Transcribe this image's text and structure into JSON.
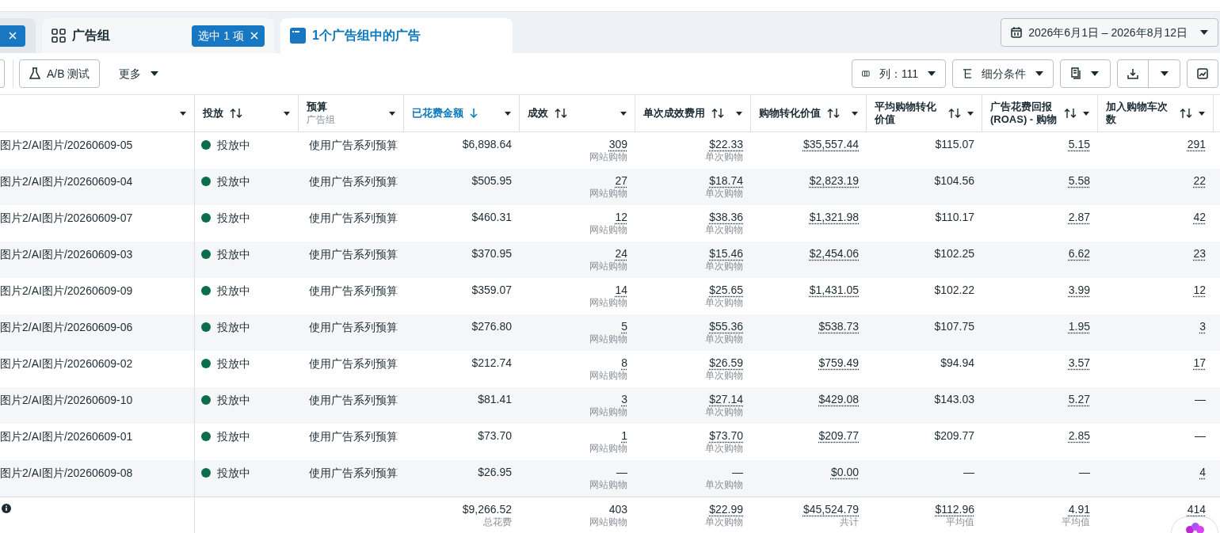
{
  "tabs": [
    {
      "kind": "cut",
      "selected": false
    },
    {
      "kind": "adsets",
      "label": "广告组",
      "chip": "选中 1 项",
      "selected": false
    },
    {
      "kind": "ads",
      "label": "1个广告组中的广告",
      "selected": true
    }
  ],
  "date_range": "2026年6月1日 – 2026年8月12日",
  "toolbar_left": [
    {
      "kind": "ab",
      "label": "A/B 测试"
    },
    {
      "kind": "more",
      "label": "更多"
    }
  ],
  "toolbar_right": [
    {
      "kind": "columns",
      "label": "列：111"
    },
    {
      "kind": "breakdown",
      "label": "细分条件"
    },
    {
      "kind": "reports"
    },
    {
      "kind": "export"
    },
    {
      "kind": "chart"
    }
  ],
  "table": {
    "columns": [
      {
        "sortable": false
      },
      {
        "label": "投放",
        "sortable": true,
        "active": false
      },
      {
        "label": "预算",
        "sublabel": "广告组",
        "sortable": false,
        "active": false
      },
      {
        "label": "已花费金额",
        "sortable": true,
        "active": true,
        "dotted": false
      },
      {
        "label": "成效",
        "sortable": true,
        "active": false,
        "dotted": true
      },
      {
        "label": "单次成效费用",
        "sortable": true,
        "active": false,
        "dotted": true
      },
      {
        "label": "购物转化价值",
        "sortable": true,
        "active": false,
        "dotted": true
      },
      {
        "label": "平均购物转化价值",
        "sortable": true,
        "active": false,
        "dotted": false
      },
      {
        "label": "广告花费回报 (ROAS) - 购物",
        "sortable": true,
        "active": false,
        "dotted": true
      },
      {
        "label": "加入购物车次数",
        "sortable": true,
        "active": false,
        "dotted": true
      }
    ],
    "rows": [
      {
        "name": "图片2/AI图片/20260609-05",
        "status": "投放中",
        "active": true,
        "budget": "使用广告系列预算",
        "metrics": [
          [
            "$6,898.64"
          ],
          [
            "309",
            "网站购物"
          ],
          [
            "$22.33",
            "单次购物"
          ],
          [
            "$35,557.44"
          ],
          [
            "$115.07"
          ],
          [
            "5.15"
          ],
          [
            "291"
          ]
        ]
      },
      {
        "name": "图片2/AI图片/20260609-04",
        "status": "投放中",
        "active": true,
        "budget": "使用广告系列预算",
        "metrics": [
          [
            "$505.95"
          ],
          [
            "27",
            "网站购物"
          ],
          [
            "$18.74",
            "单次购物"
          ],
          [
            "$2,823.19"
          ],
          [
            "$104.56"
          ],
          [
            "5.58"
          ],
          [
            "22"
          ]
        ]
      },
      {
        "name": "图片2/AI图片/20260609-07",
        "status": "投放中",
        "active": true,
        "budget": "使用广告系列预算",
        "metrics": [
          [
            "$460.31"
          ],
          [
            "12",
            "网站购物"
          ],
          [
            "$38.36",
            "单次购物"
          ],
          [
            "$1,321.98"
          ],
          [
            "$110.17"
          ],
          [
            "2.87"
          ],
          [
            "42"
          ]
        ]
      },
      {
        "name": "图片2/AI图片/20260609-03",
        "status": "投放中",
        "active": true,
        "budget": "使用广告系列预算",
        "metrics": [
          [
            "$370.95"
          ],
          [
            "24",
            "网站购物"
          ],
          [
            "$15.46",
            "单次购物"
          ],
          [
            "$2,454.06"
          ],
          [
            "$102.25"
          ],
          [
            "6.62"
          ],
          [
            "23"
          ]
        ]
      },
      {
        "name": "图片2/AI图片/20260609-09",
        "status": "投放中",
        "active": true,
        "budget": "使用广告系列预算",
        "metrics": [
          [
            "$359.07"
          ],
          [
            "14",
            "网站购物"
          ],
          [
            "$25.65",
            "单次购物"
          ],
          [
            "$1,431.05"
          ],
          [
            "$102.22"
          ],
          [
            "3.99"
          ],
          [
            "12"
          ]
        ]
      },
      {
        "name": "图片2/AI图片/20260609-06",
        "status": "投放中",
        "active": true,
        "budget": "使用广告系列预算",
        "metrics": [
          [
            "$276.80"
          ],
          [
            "5",
            "网站购物"
          ],
          [
            "$55.36",
            "单次购物"
          ],
          [
            "$538.73"
          ],
          [
            "$107.75"
          ],
          [
            "1.95"
          ],
          [
            "3"
          ]
        ]
      },
      {
        "name": "图片2/AI图片/20260609-02",
        "status": "投放中",
        "active": true,
        "budget": "使用广告系列预算",
        "metrics": [
          [
            "$212.74"
          ],
          [
            "8",
            "网站购物"
          ],
          [
            "$26.59",
            "单次购物"
          ],
          [
            "$759.49"
          ],
          [
            "$94.94"
          ],
          [
            "3.57"
          ],
          [
            "17"
          ]
        ]
      },
      {
        "name": "图片2/AI图片/20260609-10",
        "status": "投放中",
        "active": true,
        "budget": "使用广告系列预算",
        "metrics": [
          [
            "$81.41"
          ],
          [
            "3",
            "网站购物"
          ],
          [
            "$27.14",
            "单次购物"
          ],
          [
            "$429.08"
          ],
          [
            "$143.03"
          ],
          [
            "5.27"
          ],
          [
            "—"
          ]
        ]
      },
      {
        "name": "图片2/AI图片/20260609-01",
        "status": "投放中",
        "active": true,
        "budget": "使用广告系列预算",
        "metrics": [
          [
            "$73.70"
          ],
          [
            "1",
            "网站购物"
          ],
          [
            "$73.70",
            "单次购物"
          ],
          [
            "$209.77"
          ],
          [
            "$209.77"
          ],
          [
            "2.85"
          ],
          [
            "—"
          ]
        ]
      },
      {
        "name": "图片2/AI图片/20260609-08",
        "status": "投放中",
        "active": true,
        "budget": "使用广告系列预算",
        "metrics": [
          [
            "$26.95"
          ],
          [
            "—",
            "网站购物"
          ],
          [
            "—",
            "单次购物"
          ],
          [
            "$0.00"
          ],
          [
            "—"
          ],
          [
            "—"
          ],
          [
            "4"
          ]
        ]
      }
    ],
    "totals": [
      {
        "value": "$9,266.52",
        "sub": "总花费",
        "dotted": false
      },
      {
        "value": "403",
        "sub": "网站购物",
        "dotted": false
      },
      {
        "value": "$22.99",
        "sub": "单次购物",
        "dotted": true
      },
      {
        "value": "$45,524.79",
        "sub": "共计",
        "dotted": true
      },
      {
        "value": "$112.96",
        "sub": "平均值",
        "dotted": true
      },
      {
        "value": "4.91",
        "sub": "平均值",
        "dotted": true
      },
      {
        "value": "414",
        "dotted": true
      }
    ]
  }
}
